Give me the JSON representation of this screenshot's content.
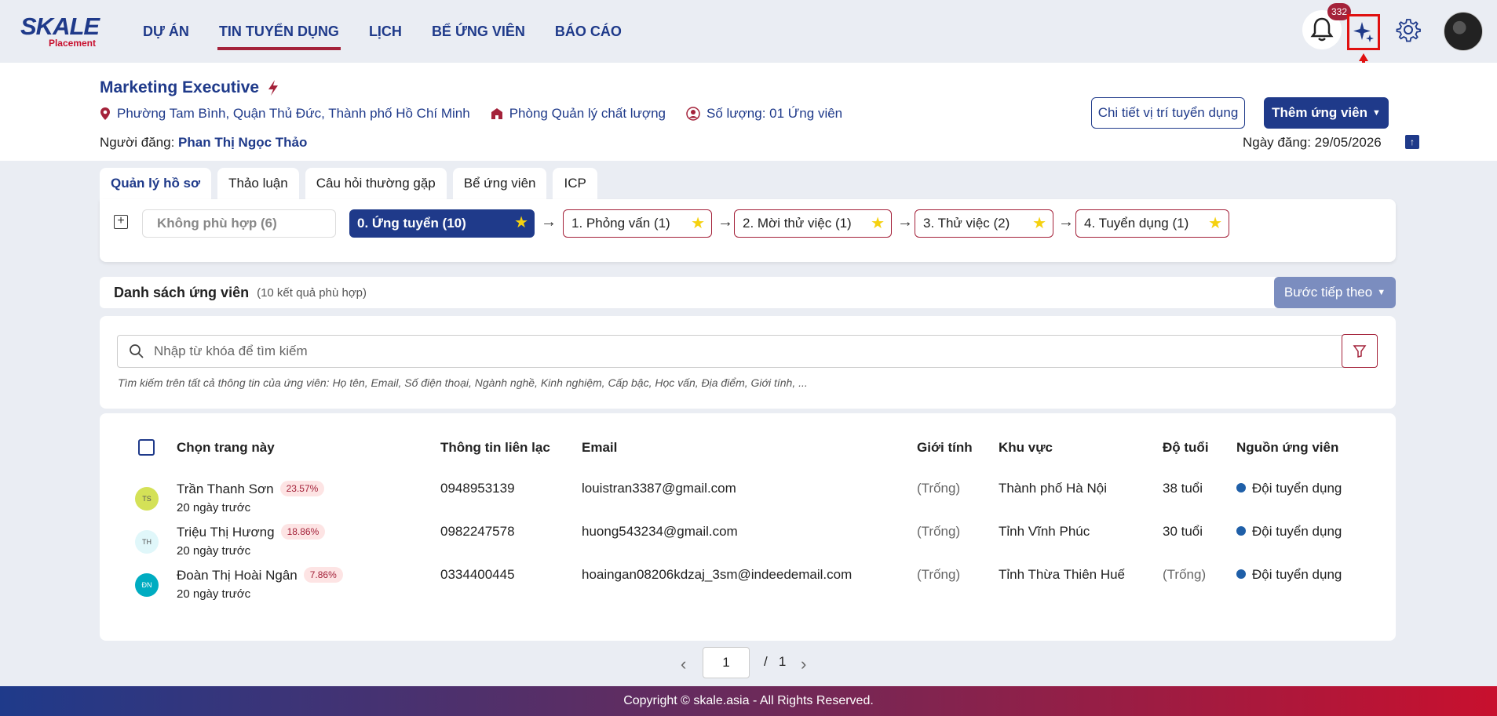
{
  "brand": {
    "name": "SKALE",
    "sub": "Placement"
  },
  "nav": {
    "items": [
      {
        "label": "DỰ ÁN"
      },
      {
        "label": "TIN TUYỂN DỤNG"
      },
      {
        "label": "LỊCH"
      },
      {
        "label": "BỂ ỨNG VIÊN"
      },
      {
        "label": "BÁO CÁO"
      }
    ],
    "active_index": 1,
    "notification_count": "332"
  },
  "job": {
    "title": "Marketing Executive",
    "location": "Phường Tam Bình, Quận Thủ Đức, Thành phố Hồ Chí Minh",
    "department": "Phòng Quản lý chất lượng",
    "quantity": "Số lượng: 01 Ứng viên",
    "posted_by_label": "Người đăng:",
    "posted_by": "Phan Thị Ngọc Thảo",
    "post_date": "Ngày đăng: 29/05/2026",
    "detail_button": "Chi tiết vị trí tuyển dụng",
    "add_button": "Thêm ứng viên"
  },
  "tabs": [
    {
      "label": "Quản lý hồ sơ"
    },
    {
      "label": "Thảo luận"
    },
    {
      "label": "Câu hỏi thường gặp"
    },
    {
      "label": "Bể ứng viên"
    },
    {
      "label": "ICP"
    }
  ],
  "pipeline": {
    "rejected": "Không phù hợp (6)",
    "stages": [
      {
        "label": "0. Ứng tuyển (10)"
      },
      {
        "label": "1. Phỏng vấn (1)"
      },
      {
        "label": "2. Mời thử việc (1)"
      },
      {
        "label": "3. Thử việc (2)"
      },
      {
        "label": "4. Tuyển dụng (1)"
      }
    ]
  },
  "list": {
    "title": "Danh sách ứng viên",
    "count": "(10 kết quả phù hợp)",
    "next_button": "Bước tiếp theo"
  },
  "search": {
    "placeholder": "Nhập từ khóa để tìm kiếm",
    "hint": "Tìm kiếm trên tất cả thông tin của ứng viên: Họ tên, Email, Số điện thoại, Ngành nghề, Kinh nghiệm, Cấp bậc, Học vấn, Địa điểm, Giới tính, ..."
  },
  "table": {
    "headers": {
      "select": "Chọn trang này",
      "contact": "Thông tin liên lạc",
      "email": "Email",
      "gender": "Giới tính",
      "region": "Khu vực",
      "age": "Độ tuổi",
      "source": "Nguồn ứng viên"
    },
    "rows": [
      {
        "initials": "TS",
        "avatar_color": "#d4e157",
        "name": "Trần Thanh Sơn",
        "match": "23.57%",
        "ago": "20 ngày trước",
        "phone": "0948953139",
        "email": "louistran3387@gmail.com",
        "gender": "(Trống)",
        "region": "Thành phố Hà Nội",
        "age": "38 tuổi",
        "source": "Đội tuyển dụng"
      },
      {
        "initials": "TH",
        "avatar_color": "#e0f7fa",
        "name": "Triệu Thị Hương",
        "match": "18.86%",
        "ago": "20 ngày trước",
        "phone": "0982247578",
        "email": "huong543234@gmail.com",
        "gender": "(Trống)",
        "region": "Tỉnh Vĩnh Phúc",
        "age": "30 tuổi",
        "source": "Đội tuyển dụng"
      },
      {
        "initials": "ĐN",
        "avatar_color": "#00acc1",
        "name": "Đoàn Thị Hoài Ngân",
        "match": "7.86%",
        "ago": "20 ngày trước",
        "phone": "0334400445",
        "email": "hoaingan08206kdzaj_3sm@indeedemail.com",
        "gender": "(Trống)",
        "region": "Tỉnh Thừa Thiên Huế",
        "age": "(Trống)",
        "source": "Đội tuyển dụng"
      }
    ]
  },
  "pagination": {
    "current": "1",
    "separator": "/",
    "total": "1"
  },
  "footer": "Copyright © skale.asia - All Rights Reserved."
}
